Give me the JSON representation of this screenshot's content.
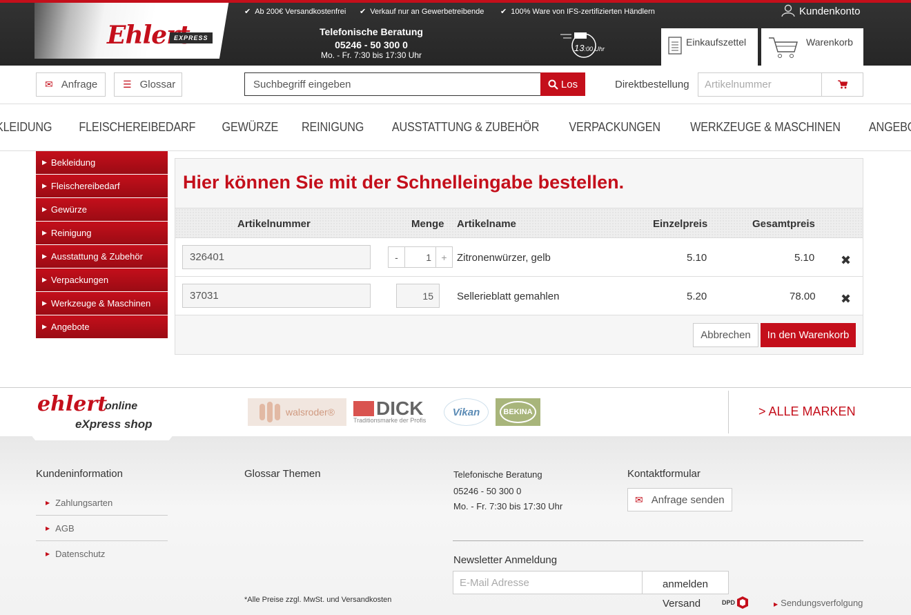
{
  "header": {
    "usps": [
      "Ab 200€ Versandkostenfrei",
      "Verkauf nur an Gewerbetreibende",
      "100% Ware von IFS-zertifizierten Händlern"
    ],
    "account_label": "Kundenkonto",
    "logo_text": "Ehlert",
    "logo_badge": "EXPRESS",
    "phone": {
      "title": "Telefonische Beratung",
      "number": "05246 - 50 300 0",
      "hours": "Mo. - Fr. 7:30 bis 17:30 Uhr"
    },
    "delivery_time": "13",
    "delivery_time_suffix": ":00 Uhr",
    "shopping_list_label": "Einkaufszettel",
    "cart_label": "Warenkorb"
  },
  "toolbar": {
    "anfrage_label": "Anfrage",
    "glossar_label": "Glossar",
    "search_placeholder": "Suchbegriff eingeben",
    "search_button": "Los",
    "direct_order_label": "Direktbestellung",
    "direct_order_placeholder": "Artikelnummer"
  },
  "nav": [
    "BEKLEIDUNG",
    "FLEISCHEREIBEDARF",
    "GEWÜRZE",
    "REINIGUNG",
    "AUSSTATTUNG & ZUBEHÖR",
    "VERPACKUNGEN",
    "WERKZEUGE & MASCHINEN",
    "ANGEBOTE"
  ],
  "sidebar": [
    "Bekleidung",
    "Fleischereibedarf",
    "Gewürze",
    "Reinigung",
    "Ausstattung & Zubehör",
    "Verpackungen",
    "Werkzeuge & Maschinen",
    "Angebote"
  ],
  "quick_order": {
    "title": "Hier können Sie mit der Schnelleingabe bestellen.",
    "columns": {
      "article_number": "Artikelnummer",
      "quantity": "Menge",
      "article_name": "Artikelname",
      "unit_price": "Einzelpreis",
      "total_price": "Gesamtpreis"
    },
    "rows": [
      {
        "article_number": "326401",
        "quantity": "1",
        "name": "Zitronenwürzer, gelb",
        "unit_price": "5.10",
        "total": "5.10"
      },
      {
        "article_number": "37031",
        "quantity": "15",
        "name": "Sellerieblatt gemahlen",
        "unit_price": "5.20",
        "total": "78.00"
      }
    ],
    "stepper_minus": "-",
    "stepper_plus": "+",
    "cancel_label": "Abbrechen",
    "add_to_cart_label": "In den Warenkorb"
  },
  "brands": {
    "footer_logo_1": "ehlert",
    "footer_logo_2": "online",
    "footer_logo_3": "eXpress shop",
    "items": [
      "walsroder®",
      "DICK",
      "Traditionsmarke der Profis",
      "Vikan",
      "BEKINA"
    ],
    "all_brands_label": "> ALLE MARKEN"
  },
  "footer": {
    "customer_info_title": "Kundeninformation",
    "customer_links": [
      "Zahlungsarten",
      "AGB",
      "Datenschutz"
    ],
    "glossary_title": "Glossar Themen",
    "phone_title": "Telefonische Beratung",
    "phone_number": "05246 - 50 300 0",
    "phone_hours": "Mo. - Fr. 7:30 bis 17:30 Uhr",
    "contact_title": "Kontaktformular",
    "contact_button": "Anfrage senden",
    "newsletter_title": "Newsletter Anmeldung",
    "newsletter_placeholder": "E-Mail Adresse",
    "newsletter_button": "anmelden",
    "price_note": "*Alle Preise zzgl. MwSt. und Versandkosten",
    "shipping_label": "Versand",
    "shipping_carrier": "DPD",
    "tracking_label": "Sendungsverfolgung"
  },
  "colors": {
    "accent": "#c40f1b",
    "header_bg": "#2c2c2c"
  }
}
